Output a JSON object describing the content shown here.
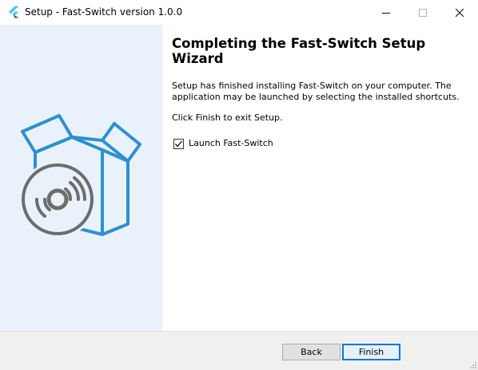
{
  "window": {
    "title": "Setup - Fast-Switch version 1.0.0",
    "icon": "flutter-logo-icon"
  },
  "title_controls": {
    "minimize_icon": "minimize-icon",
    "maximize_icon": "maximize-icon",
    "close_icon": "close-icon"
  },
  "sidebar": {
    "image": "box-with-disc-icon",
    "bg_color": "#e9f2fa",
    "accent_color": "#2f8fd0"
  },
  "main": {
    "heading": "Completing the Fast-Switch Setup Wizard",
    "body": "Setup has finished installing Fast-Switch on your computer. The application may be launched by selecting the installed shortcuts.",
    "exit_instruction": "Click Finish to exit Setup.",
    "launch_checkbox": {
      "label": "Launch Fast-Switch",
      "checked": true
    }
  },
  "footer": {
    "back_label": "Back",
    "finish_label": "Finish"
  }
}
